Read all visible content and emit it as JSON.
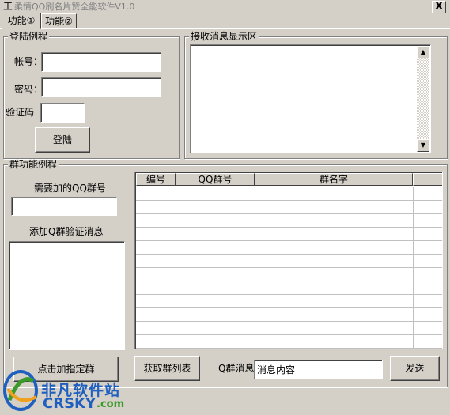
{
  "window": {
    "title": "柔情QQ刷名片赞全能软件V1.0",
    "close_label": "X"
  },
  "tabs": [
    {
      "label": "功能①",
      "active": true
    },
    {
      "label": "功能②",
      "active": false
    }
  ],
  "login": {
    "group_title": "登陆例程",
    "account_label": "帐号：",
    "password_label": "密码：",
    "captcha_label": "验证码",
    "account_value": "",
    "password_value": "",
    "captcha_value": "",
    "login_button": "登陆"
  },
  "messages": {
    "group_title": "接收消息显示区",
    "content": ""
  },
  "group_func": {
    "group_title": "群功能例程",
    "need_add_label": "需要加的QQ群号",
    "group_number_value": "",
    "add_verify_label": "添加Q群验证消息",
    "verify_message_value": "",
    "add_group_button": "点击加指定群",
    "table": {
      "columns": [
        "编号",
        "QQ群号",
        "群名字",
        ""
      ],
      "rows": []
    },
    "get_list_button": "获取群列表",
    "qmsg_label": "Q群消息",
    "qmsg_value": "消息内容",
    "send_button": "发送"
  },
  "watermark": {
    "cn_text": "非凡软件站",
    "en_text": "CRSKY",
    "domain_text": ".com"
  },
  "colors": {
    "face": "#d4d0c8",
    "watermark_blue": "#1f5fc0",
    "watermark_green": "#3a9a2a"
  }
}
